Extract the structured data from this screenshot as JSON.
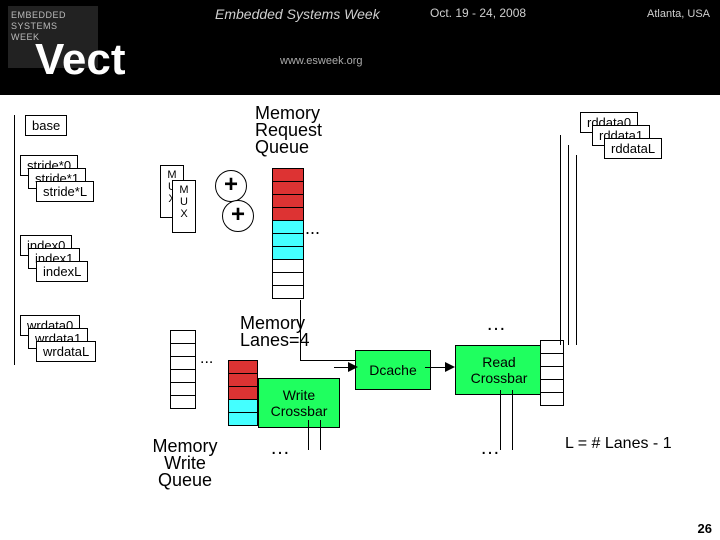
{
  "header": {
    "logo_line1": "EMBEDDED",
    "logo_line2": "SYSTEMS",
    "logo_line3": "WEEK",
    "title": "Embedded Systems Week",
    "date": "Oct. 19 - 24, 2008",
    "right": "Atlanta, USA",
    "url": "www.esweek.org",
    "corner": "Vect"
  },
  "inputs": {
    "base": "base",
    "stride0": "stride*0",
    "stride1": "stride*1",
    "strideL": "stride*L",
    "index0": "index0",
    "index1": "index1",
    "indexL": "indexL",
    "wr0": "wrdata0",
    "wr1": "wrdata1",
    "wrL": "wrdataL"
  },
  "mux": "M\nU\nX",
  "plus": "+",
  "mrq": "Memory\nRequest\nQueue",
  "lanes": "Memory\nLanes=4",
  "dcache": "Dcache",
  "readxbar": "Read\nCrossbar",
  "writexbar": "Write\nCrossbar",
  "mwq": "Memory\nWrite\nQueue",
  "rd0": "rddata0",
  "rd1": "rddata1",
  "rdL": "rddataL",
  "dots": "…",
  "eleqn": "L = # Lanes - 1",
  "page": "26"
}
